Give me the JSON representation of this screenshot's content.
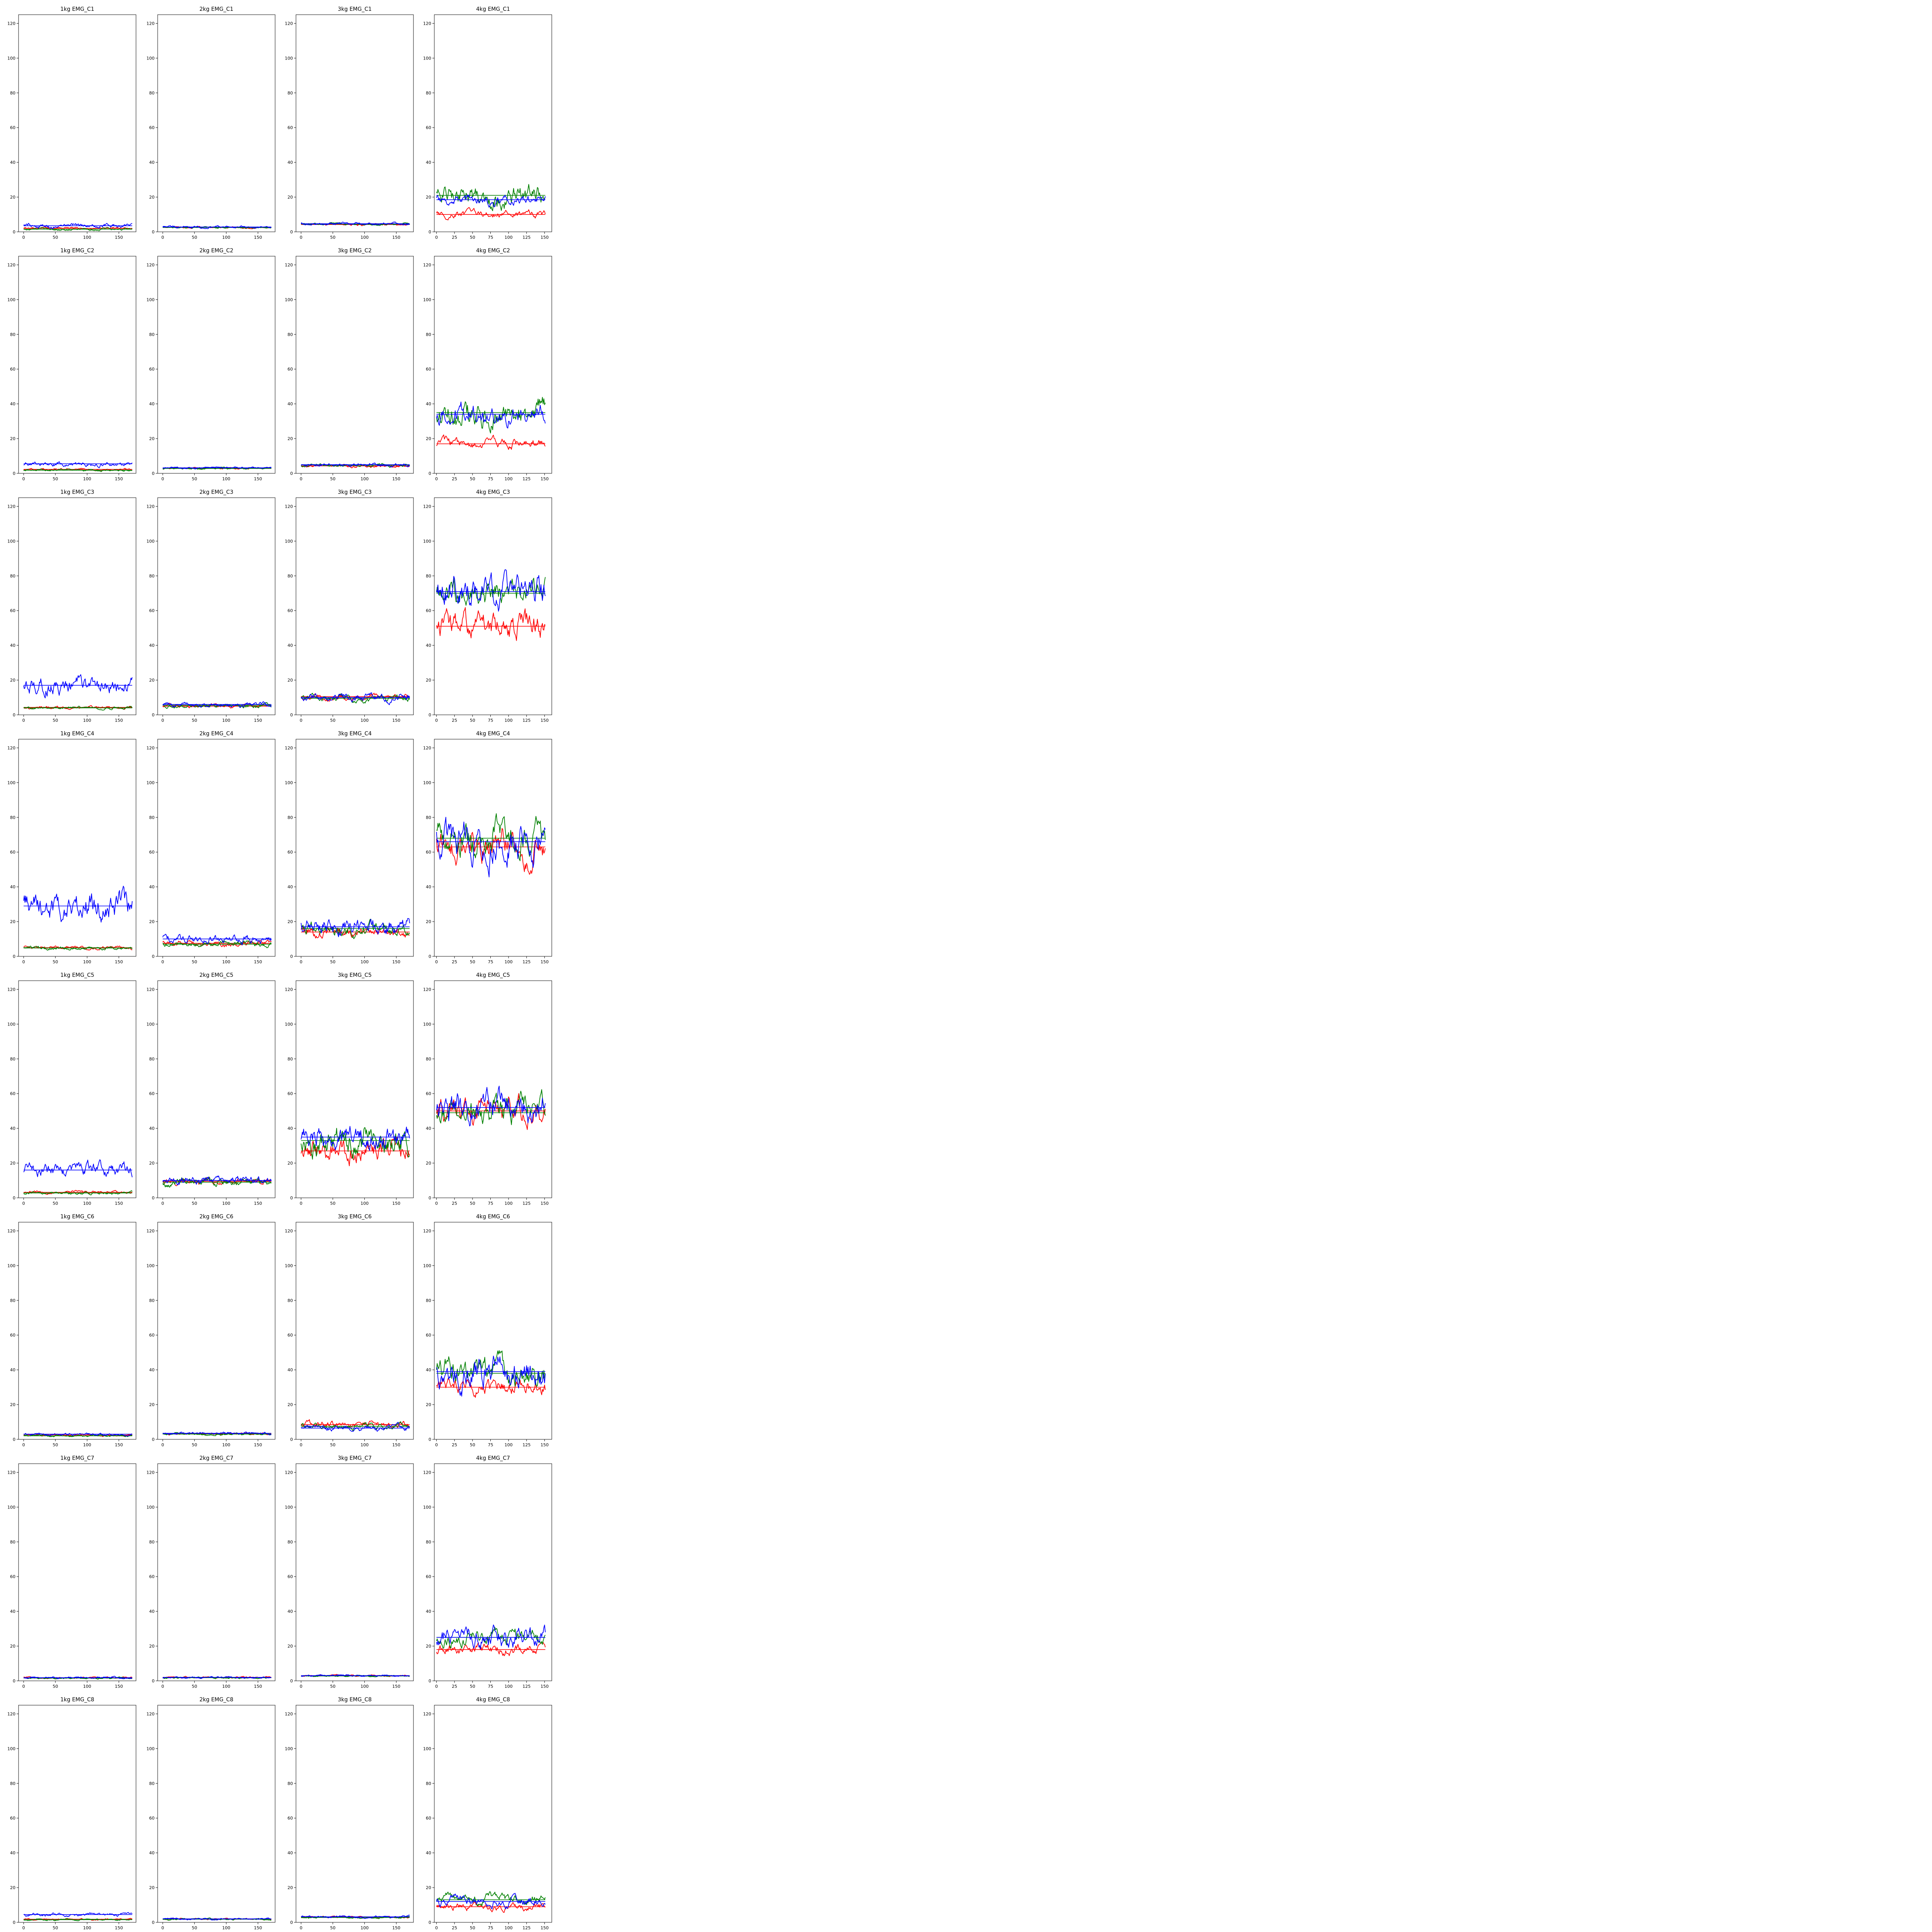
{
  "chart_data": {
    "type": "line",
    "grid": false,
    "ylim": [
      0,
      125
    ],
    "yticks": [
      0,
      20,
      40,
      60,
      80,
      100,
      120
    ],
    "column_xlim": [
      [
        -8,
        177
      ],
      [
        -8,
        177
      ],
      [
        -8,
        177
      ],
      [
        -3,
        160
      ]
    ],
    "column_xticks": [
      [
        0,
        50,
        100,
        150
      ],
      [
        0,
        50,
        100,
        150
      ],
      [
        0,
        50,
        100,
        150
      ],
      [
        0,
        25,
        50,
        75,
        100,
        125,
        150
      ]
    ],
    "column_length": [
      172,
      172,
      172,
      152
    ],
    "series_colors": {
      "red": "#ff0000",
      "green": "#008000",
      "blue": "#0000ff",
      "mean": "#000000"
    },
    "panels": [
      [
        {
          "title": "1kg EMG_C1",
          "red": [
            2,
            0.4
          ],
          "green": [
            1.5,
            0.4
          ],
          "blue": [
            3.5,
            0.8
          ]
        },
        {
          "title": "2kg EMG_C1",
          "red": [
            2.5,
            0.3
          ],
          "green": [
            2.5,
            0.3
          ],
          "blue": [
            2.8,
            0.4
          ]
        },
        {
          "title": "3kg EMG_C1",
          "red": [
            4.2,
            0.4
          ],
          "green": [
            4.5,
            0.5
          ],
          "blue": [
            4.7,
            0.5
          ]
        },
        {
          "title": "4kg EMG_C1",
          "red": [
            10,
            1.5
          ],
          "green": [
            21,
            4
          ],
          "blue": [
            18.5,
            2
          ]
        }
      ],
      [
        {
          "title": "1kg EMG_C2",
          "red": [
            2.3,
            0.4
          ],
          "green": [
            1.8,
            0.4
          ],
          "blue": [
            5.5,
            0.9
          ]
        },
        {
          "title": "2kg EMG_C2",
          "red": [
            3,
            0.3
          ],
          "green": [
            2.8,
            0.3
          ],
          "blue": [
            3.2,
            0.4
          ]
        },
        {
          "title": "3kg EMG_C2",
          "red": [
            4.3,
            0.5
          ],
          "green": [
            4.8,
            0.6
          ],
          "blue": [
            5,
            0.6
          ]
        },
        {
          "title": "4kg EMG_C2",
          "red": [
            17,
            2
          ],
          "green": [
            35,
            5
          ],
          "blue": [
            34,
            4
          ]
        }
      ],
      [
        {
          "title": "1kg EMG_C3",
          "red": [
            4.3,
            0.5
          ],
          "green": [
            4,
            0.5
          ],
          "blue": [
            17,
            3
          ]
        },
        {
          "title": "2kg EMG_C3",
          "red": [
            5,
            0.7
          ],
          "green": [
            5.5,
            0.8
          ],
          "blue": [
            6,
            0.9
          ]
        },
        {
          "title": "3kg EMG_C3",
          "red": [
            10.5,
            1.2
          ],
          "green": [
            9.5,
            1.2
          ],
          "blue": [
            10,
            1.5
          ]
        },
        {
          "title": "4kg EMG_C3",
          "red": [
            51,
            5
          ],
          "green": [
            70,
            5
          ],
          "blue": [
            71,
            6
          ]
        }
      ],
      [
        {
          "title": "1kg EMG_C4",
          "red": [
            5,
            0.6
          ],
          "green": [
            4.8,
            0.6
          ],
          "blue": [
            29,
            5
          ]
        },
        {
          "title": "2kg EMG_C4",
          "red": [
            7.5,
            1
          ],
          "green": [
            7,
            1
          ],
          "blue": [
            10,
            1.5
          ]
        },
        {
          "title": "3kg EMG_C4",
          "red": [
            14,
            2
          ],
          "green": [
            16,
            2.5
          ],
          "blue": [
            17,
            3
          ]
        },
        {
          "title": "4kg EMG_C4",
          "red": [
            63,
            6
          ],
          "green": [
            68,
            6
          ],
          "blue": [
            66,
            7
          ]
        }
      ],
      [
        {
          "title": "1kg EMG_C5",
          "red": [
            3.2,
            0.5
          ],
          "green": [
            2.8,
            0.5
          ],
          "blue": [
            16,
            2.5
          ]
        },
        {
          "title": "2kg EMG_C5",
          "red": [
            9.5,
            1.2
          ],
          "green": [
            9,
            1.5
          ],
          "blue": [
            10,
            1.5
          ]
        },
        {
          "title": "3kg EMG_C5",
          "red": [
            27,
            4
          ],
          "green": [
            33,
            5
          ],
          "blue": [
            35,
            4
          ]
        },
        {
          "title": "4kg EMG_C5",
          "red": [
            50,
            5
          ],
          "green": [
            49,
            5
          ],
          "blue": [
            52,
            6
          ]
        }
      ],
      [
        {
          "title": "1kg EMG_C6",
          "red": [
            2.5,
            0.4
          ],
          "green": [
            2,
            0.4
          ],
          "blue": [
            3,
            0.5
          ]
        },
        {
          "title": "2kg EMG_C6",
          "red": [
            3.2,
            0.4
          ],
          "green": [
            3,
            0.4
          ],
          "blue": [
            3.5,
            0.5
          ]
        },
        {
          "title": "3kg EMG_C6",
          "red": [
            8.5,
            1.2
          ],
          "green": [
            7.5,
            1
          ],
          "blue": [
            6.5,
            1
          ]
        },
        {
          "title": "4kg EMG_C6",
          "red": [
            30,
            3
          ],
          "green": [
            38,
            5
          ],
          "blue": [
            39,
            6
          ]
        }
      ],
      [
        {
          "title": "1kg EMG_C7",
          "red": [
            1.8,
            0.3
          ],
          "green": [
            1.6,
            0.3
          ],
          "blue": [
            1.8,
            0.3
          ]
        },
        {
          "title": "2kg EMG_C7",
          "red": [
            2,
            0.3
          ],
          "green": [
            1.8,
            0.3
          ],
          "blue": [
            2,
            0.3
          ]
        },
        {
          "title": "3kg EMG_C7",
          "red": [
            3,
            0.3
          ],
          "green": [
            2.8,
            0.3
          ],
          "blue": [
            3,
            0.3
          ]
        },
        {
          "title": "4kg EMG_C7",
          "red": [
            18,
            2
          ],
          "green": [
            25,
            3
          ],
          "blue": [
            25,
            4
          ]
        }
      ],
      [
        {
          "title": "1kg EMG_C8",
          "red": [
            1.8,
            0.3
          ],
          "green": [
            1.5,
            0.3
          ],
          "blue": [
            4.5,
            0.6
          ]
        },
        {
          "title": "2kg EMG_C8",
          "red": [
            2,
            0.3
          ],
          "green": [
            1.8,
            0.3
          ],
          "blue": [
            2,
            0.3
          ]
        },
        {
          "title": "3kg EMG_C8",
          "red": [
            3,
            0.3
          ],
          "green": [
            2.8,
            0.3
          ],
          "blue": [
            3.2,
            0.4
          ]
        },
        {
          "title": "4kg EMG_C8",
          "red": [
            9,
            1.5
          ],
          "green": [
            13,
            2
          ],
          "blue": [
            12,
            2
          ]
        }
      ]
    ],
    "panel_value_format": "each series given as [mean, spread] of the fluctuating EMG trace; a flat black line marks each series mean"
  }
}
